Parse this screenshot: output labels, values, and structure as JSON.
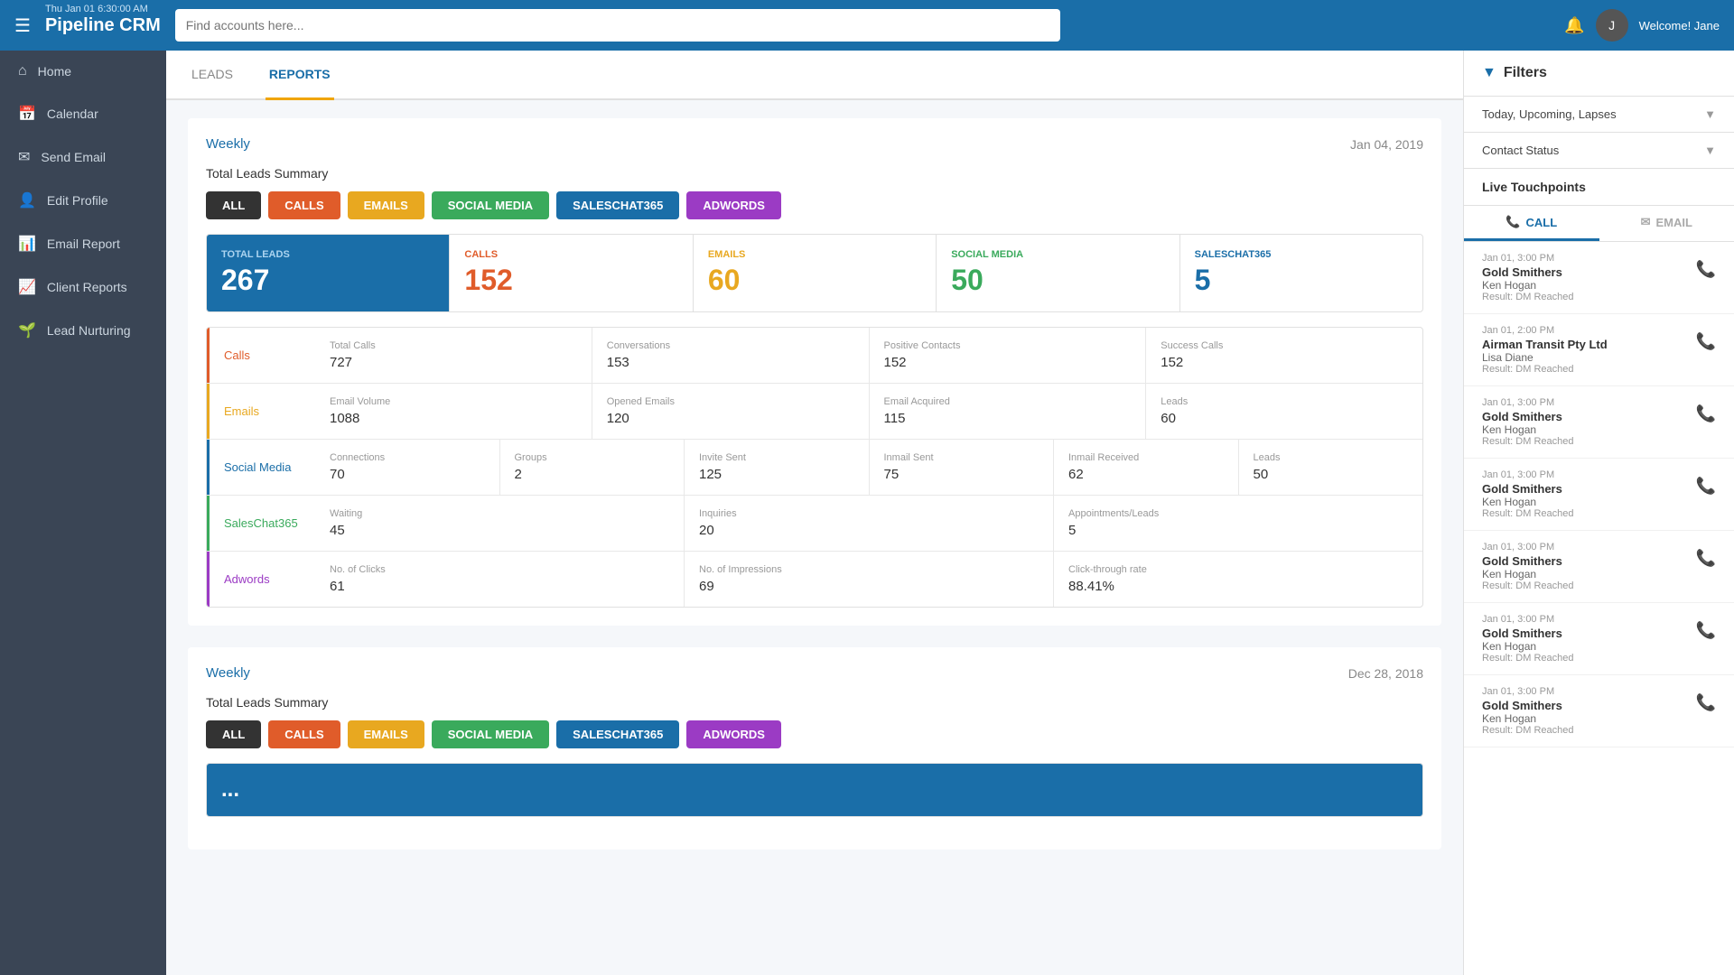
{
  "topbar": {
    "timestamp": "Thu Jan 01 6:30:00 AM",
    "logo": "Pipeline CRM",
    "search_placeholder": "Find accounts here...",
    "welcome_text": "Welcome! Jane",
    "menu_icon": "☰",
    "bell_icon": "🔔"
  },
  "sidebar": {
    "items": [
      {
        "id": "home",
        "label": "Home",
        "icon": "⌂"
      },
      {
        "id": "calendar",
        "label": "Calendar",
        "icon": "📅"
      },
      {
        "id": "send-email",
        "label": "Send Email",
        "icon": "✉"
      },
      {
        "id": "edit-profile",
        "label": "Edit Profile",
        "icon": "👤"
      },
      {
        "id": "email-report",
        "label": "Email Report",
        "icon": "📊"
      },
      {
        "id": "client-reports",
        "label": "Client Reports",
        "icon": "📈"
      },
      {
        "id": "lead-nurturing",
        "label": "Lead Nurturing",
        "icon": "🌱"
      }
    ]
  },
  "tabs": {
    "items": [
      {
        "id": "leads",
        "label": "LEADS"
      },
      {
        "id": "reports",
        "label": "REPORTS",
        "active": true
      }
    ]
  },
  "weekly_block_1": {
    "label": "Weekly",
    "date": "Jan 04, 2019",
    "section_title": "Total Leads Summary",
    "filter_buttons": [
      {
        "id": "all",
        "label": "ALL",
        "class": "all"
      },
      {
        "id": "calls",
        "label": "CALLS",
        "class": "calls"
      },
      {
        "id": "emails",
        "label": "EMAILS",
        "class": "emails"
      },
      {
        "id": "social",
        "label": "SOCIAL MEDIA",
        "class": "social"
      },
      {
        "id": "saleschat",
        "label": "SALESCHAT365",
        "class": "saleschat"
      },
      {
        "id": "adwords",
        "label": "ADWORDS",
        "class": "adwords"
      }
    ],
    "totals": {
      "total_leads_label": "TOTAL LEADS",
      "total_leads_value": "267",
      "calls_label": "CALLS",
      "calls_value": "152",
      "emails_label": "EMAILS",
      "emails_value": "60",
      "social_label": "SOCIAL MEDIA",
      "social_value": "50",
      "saleschat_label": "SALESCHAT365",
      "saleschat_value": "5"
    },
    "stats": [
      {
        "category": "Calls",
        "class": "calls",
        "metrics": [
          {
            "label": "Total Calls",
            "value": "727"
          },
          {
            "label": "Conversations",
            "value": "153"
          },
          {
            "label": "Positive Contacts",
            "value": "152"
          },
          {
            "label": "Success Calls",
            "value": "152"
          }
        ]
      },
      {
        "category": "Emails",
        "class": "emails",
        "metrics": [
          {
            "label": "Email Volume",
            "value": "1088"
          },
          {
            "label": "Opened Emails",
            "value": "120"
          },
          {
            "label": "Email Acquired",
            "value": "115"
          },
          {
            "label": "Leads",
            "value": "60"
          }
        ]
      },
      {
        "category": "Social Media",
        "class": "social",
        "metrics": [
          {
            "label": "Connections",
            "value": "70"
          },
          {
            "label": "Groups",
            "value": "2"
          },
          {
            "label": "Invite Sent",
            "value": "125"
          },
          {
            "label": "Inmail Sent",
            "value": "75"
          },
          {
            "label": "Inmail Received",
            "value": "62"
          },
          {
            "label": "Leads",
            "value": "50"
          }
        ]
      },
      {
        "category": "SalesChat365",
        "class": "saleschat",
        "metrics": [
          {
            "label": "Waiting",
            "value": "45"
          },
          {
            "label": "Inquiries",
            "value": "20"
          },
          {
            "label": "Appointments/Leads",
            "value": "5"
          }
        ]
      },
      {
        "category": "Adwords",
        "class": "adwords",
        "metrics": [
          {
            "label": "No. of Clicks",
            "value": "61"
          },
          {
            "label": "No. of Impressions",
            "value": "69"
          },
          {
            "label": "Click-through rate",
            "value": "88.41%"
          }
        ]
      }
    ]
  },
  "weekly_block_2": {
    "label": "Weekly",
    "date": "Dec 28, 2018",
    "section_title": "Total Leads Summary",
    "filter_buttons": [
      {
        "id": "all2",
        "label": "ALL",
        "class": "all"
      },
      {
        "id": "calls2",
        "label": "CALLS",
        "class": "calls"
      },
      {
        "id": "emails2",
        "label": "EMAILS",
        "class": "emails"
      },
      {
        "id": "social2",
        "label": "SOCIAL MEDIA",
        "class": "social"
      },
      {
        "id": "saleschat2",
        "label": "SALESCHAT365",
        "class": "saleschat"
      },
      {
        "id": "adwords2",
        "label": "ADWORDS",
        "class": "adwords"
      }
    ]
  },
  "right_panel": {
    "filters_label": "Filters",
    "filter1_label": "Today, Upcoming, Lapses",
    "filter2_label": "Contact Status",
    "live_touchpoints_label": "Live Touchpoints",
    "tabs": [
      {
        "id": "call",
        "label": "CALL",
        "icon": "📞",
        "active": true
      },
      {
        "id": "email",
        "label": "EMAIL",
        "icon": "✉",
        "active": false
      }
    ],
    "touchpoints": [
      {
        "time": "Jan 01, 3:00 PM",
        "company": "Gold Smithers",
        "person": "Ken Hogan",
        "result": "Result: DM Reached"
      },
      {
        "time": "Jan 01, 2:00 PM",
        "company": "Airman Transit Pty Ltd",
        "person": "Lisa Diane",
        "result": "Result: DM Reached"
      },
      {
        "time": "Jan 01, 3:00 PM",
        "company": "Gold Smithers",
        "person": "Ken Hogan",
        "result": "Result: DM Reached"
      },
      {
        "time": "Jan 01, 3:00 PM",
        "company": "Gold Smithers",
        "person": "Ken Hogan",
        "result": "Result: DM Reached"
      },
      {
        "time": "Jan 01, 3:00 PM",
        "company": "Gold Smithers",
        "person": "Ken Hogan",
        "result": "Result: DM Reached"
      },
      {
        "time": "Jan 01, 3:00 PM",
        "company": "Gold Smithers",
        "person": "Ken Hogan",
        "result": "Result: DM Reached"
      },
      {
        "time": "Jan 01, 3:00 PM",
        "company": "Gold Smithers",
        "person": "Ken Hogan",
        "result": "Result: DM Reached"
      }
    ]
  }
}
